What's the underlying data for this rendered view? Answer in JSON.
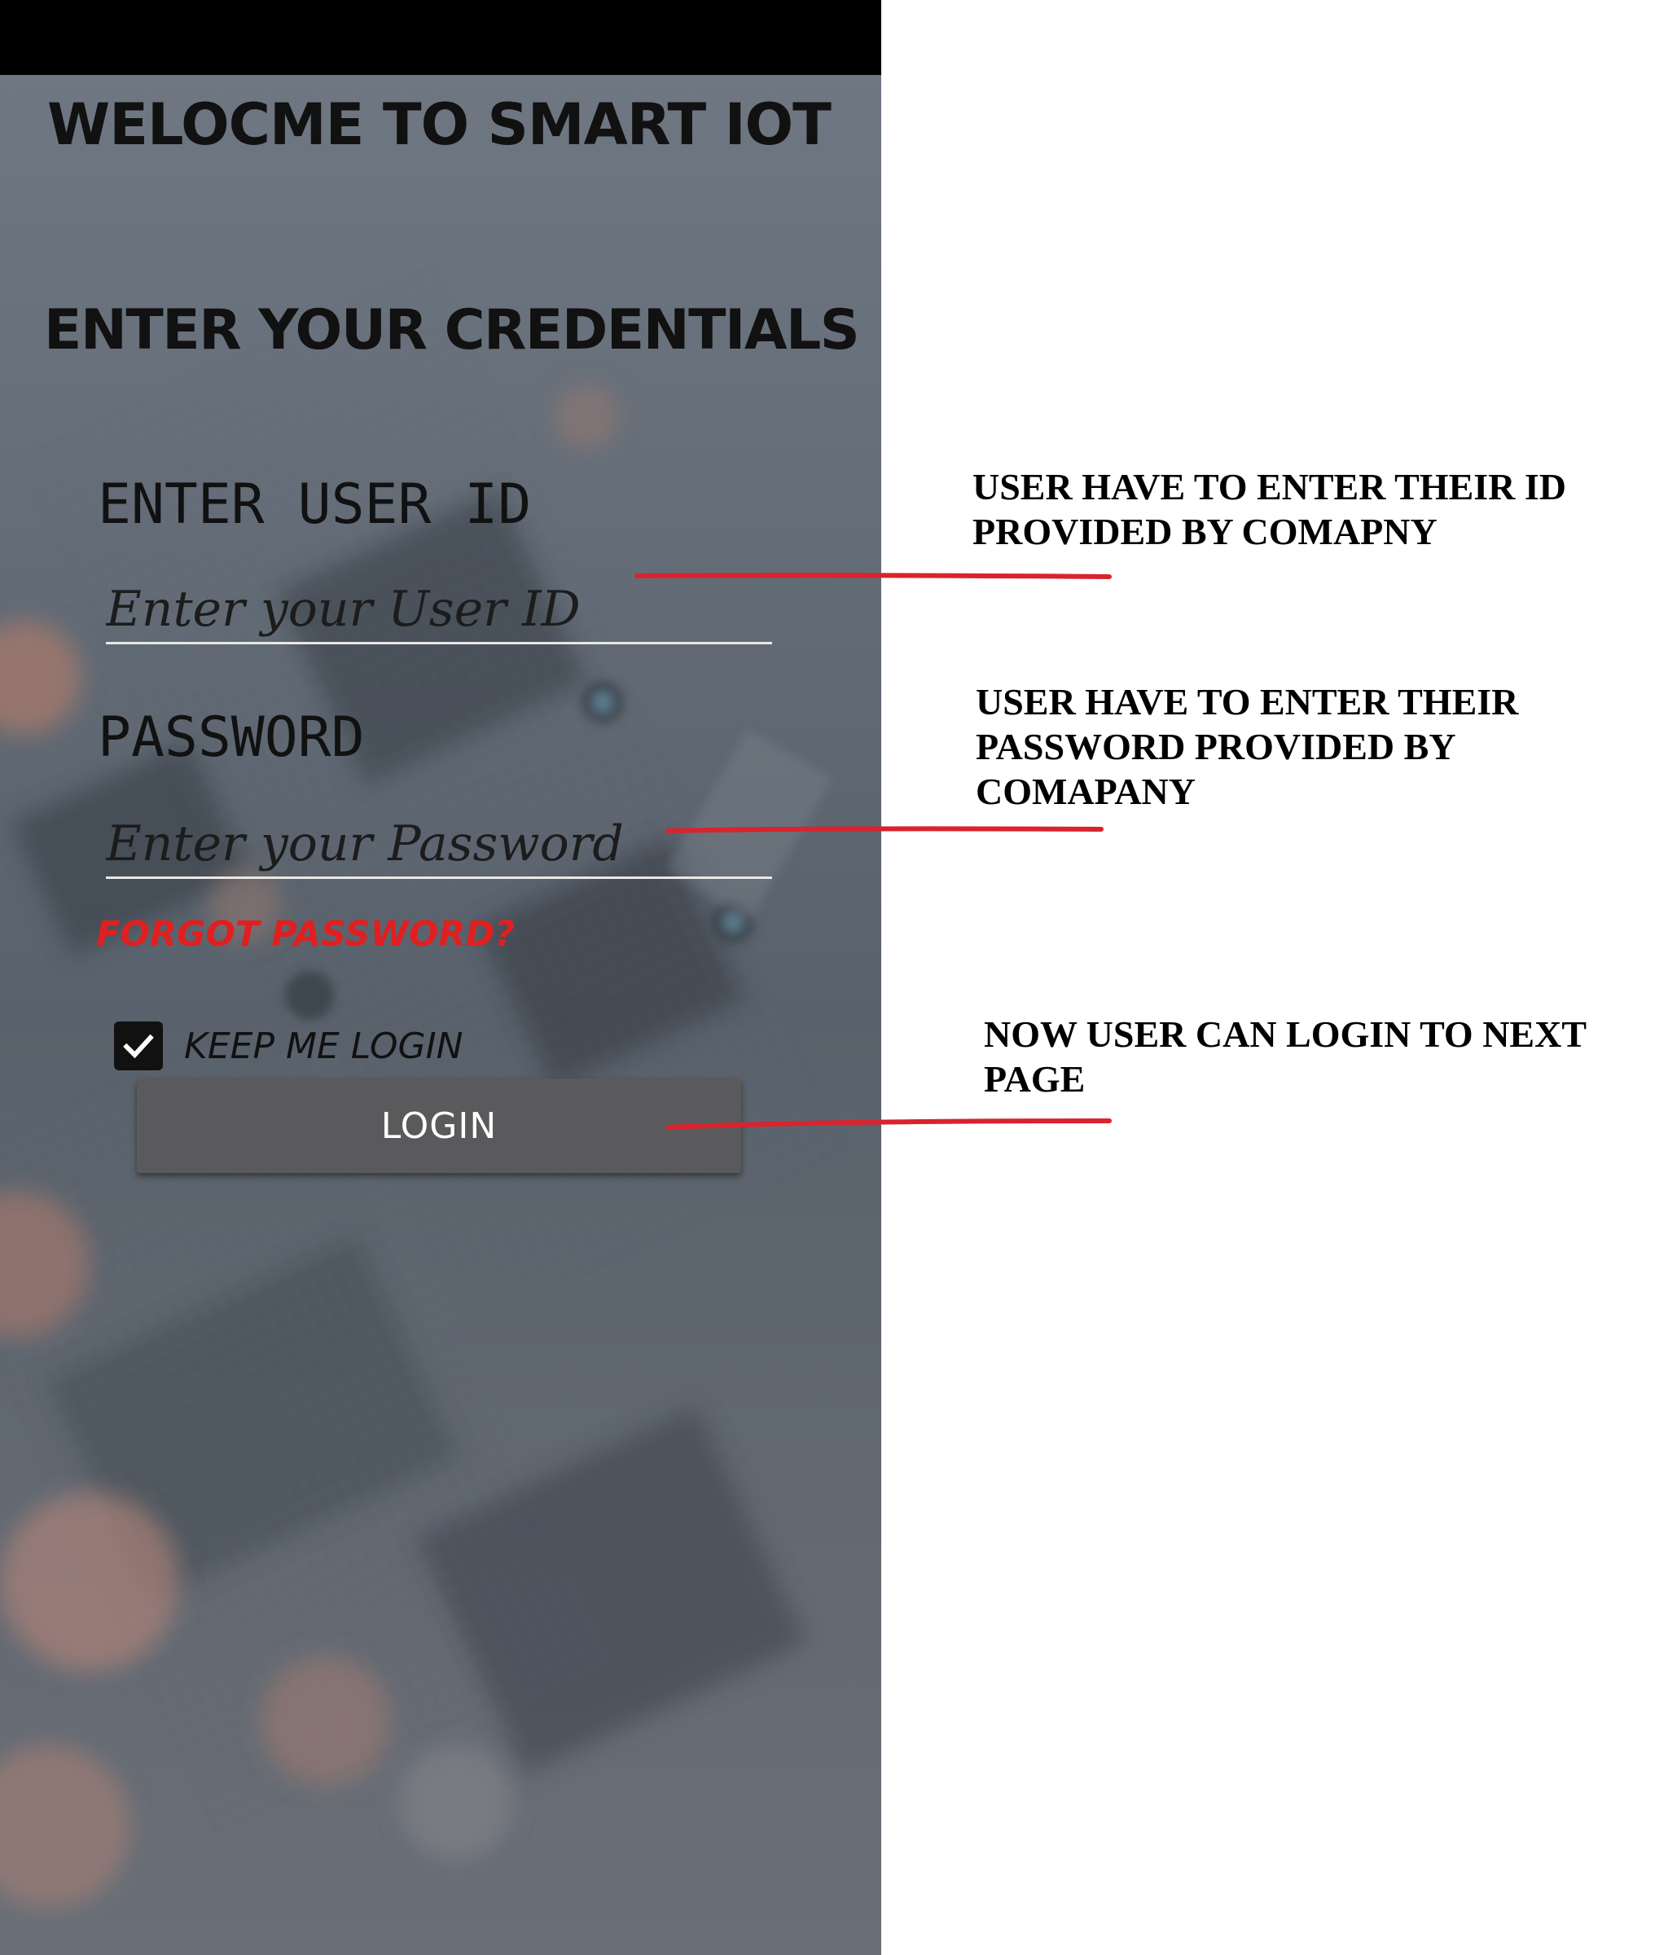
{
  "app": {
    "title": "WELOCME TO SMART IOT",
    "section_title": "ENTER YOUR CREDENTIALS"
  },
  "form": {
    "user_id_label": "ENTER USER ID",
    "user_id_placeholder": "Enter your User ID",
    "password_label": "PASSWORD",
    "password_placeholder": "Enter your Password",
    "forgot_password": "FORGOT PASSWORD?",
    "keep_me_login": "KEEP ME LOGIN",
    "keep_me_login_checked": true,
    "login_button": "LOGIN"
  },
  "annotations": {
    "user_id_note": "USER HAVE TO ENTER THEIR ID PROVIDED BY COMAPNY",
    "password_note": "USER HAVE TO ENTER THEIR PASSWORD PROVIDED BY COMAPANY",
    "login_note": "NOW USER CAN LOGIN TO NEXT PAGE"
  },
  "colors": {
    "accent_red": "#e02020",
    "leader_line": "#d9232e",
    "status_bar": "#000000",
    "button_bg": "#5a5a5c",
    "background_tint": "#5d6670"
  },
  "icons": {
    "checkbox": "check-icon"
  }
}
